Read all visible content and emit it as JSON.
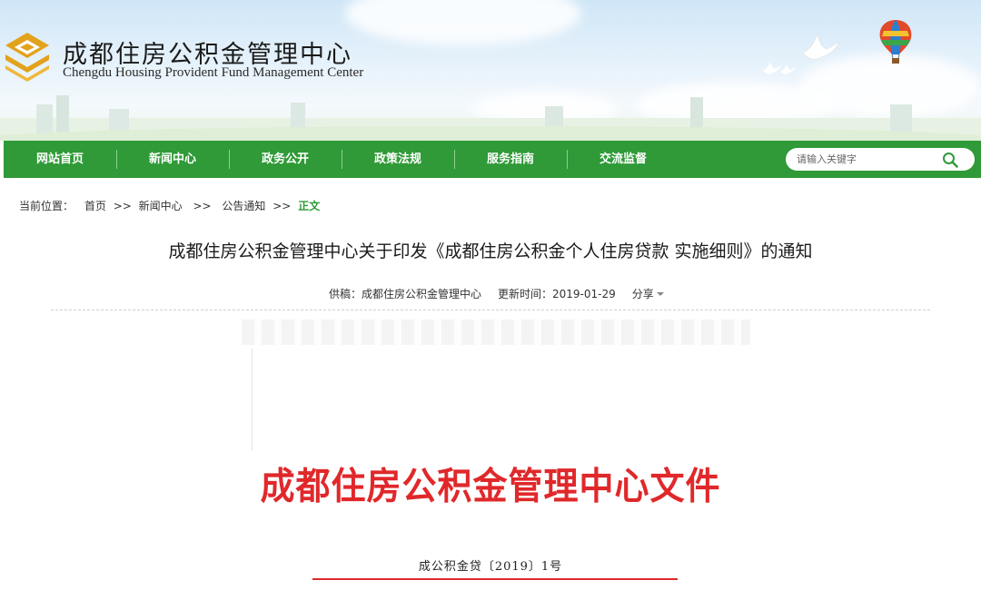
{
  "header": {
    "org_name_cn": "成都住房公积金管理中心",
    "org_name_en": "Chengdu Housing Provident Fund Management Center"
  },
  "nav": {
    "items": [
      {
        "label": "网站首页"
      },
      {
        "label": "新闻中心"
      },
      {
        "label": "政务公开"
      },
      {
        "label": "政策法规"
      },
      {
        "label": "服务指南"
      },
      {
        "label": "交流监督"
      }
    ],
    "search_placeholder": "请输入关键字"
  },
  "breadcrumb": {
    "prefix": "当前位置：",
    "items": [
      "首页",
      "新闻中心",
      "公告通知"
    ],
    "current": "正文",
    "sep1": ">>",
    "sep2": ">>",
    "sep3": ">>"
  },
  "article": {
    "title": "成都住房公积金管理中心关于印发《成都住房公积金个人住房贷款 实施细则》的通知",
    "source": "供稿：成都住房公积金管理中心",
    "updated": "更新时间：2019-01-29",
    "share_label": "分享"
  },
  "document": {
    "heading": "成都住房公积金管理中心文件",
    "number": "成公积金贷〔2019〕1号"
  },
  "colors": {
    "nav_green": "#2f9a37",
    "doc_red": "#e0282b",
    "logo_gold": "#e2a21c"
  }
}
